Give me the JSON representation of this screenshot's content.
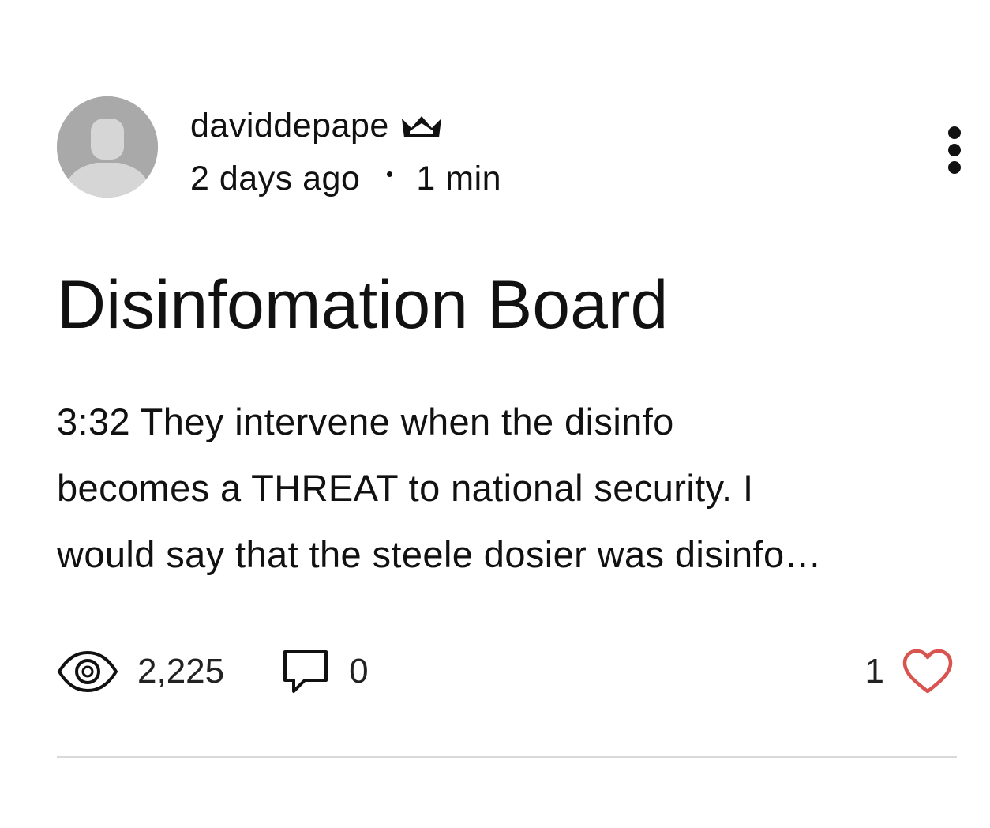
{
  "post": {
    "author": {
      "name": "daviddepape",
      "badge_icon": "crown-icon",
      "avatar_icon": "default-avatar-icon"
    },
    "meta": {
      "posted": "2 days ago",
      "read_time": "1 min"
    },
    "menu_icon": "more-vertical-icon",
    "title": "Disinfomation Board",
    "excerpt_lines": [
      "3:32 They intervene when the disinfo",
      "becomes a THREAT to national security. I",
      "would say that the steele dosier was disinfo…"
    ],
    "stats": {
      "views": "2,225",
      "views_icon": "eye-icon",
      "comments": "0",
      "comments_icon": "comment-icon",
      "likes": "1",
      "likes_icon": "heart-icon"
    }
  },
  "colors": {
    "text": "#111111",
    "avatar_bg": "#a9a9a9",
    "avatar_figure": "#d6d6d6",
    "heart": "#d9534f",
    "divider": "#d9d9d9"
  }
}
